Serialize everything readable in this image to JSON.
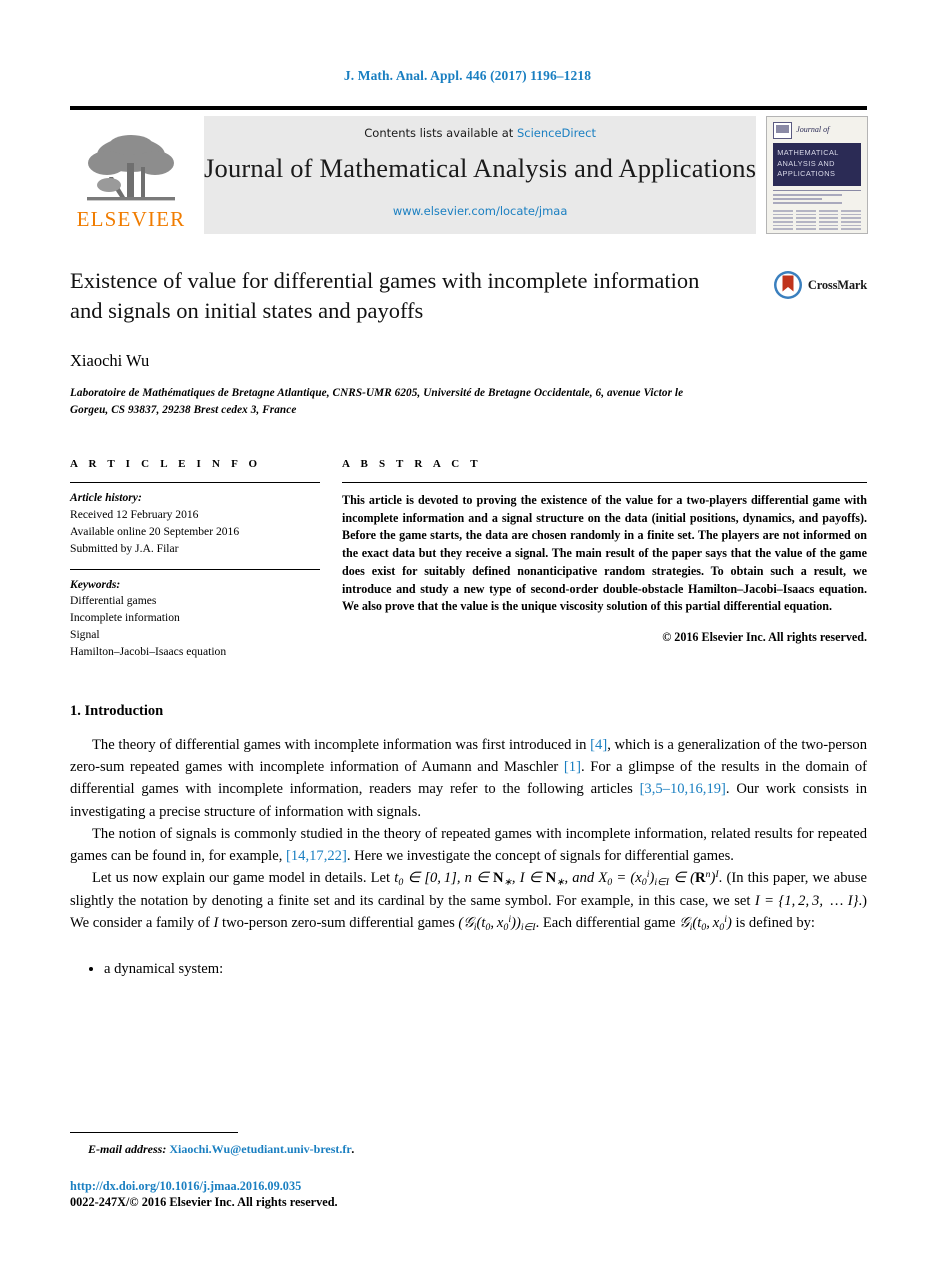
{
  "running_head": "J. Math. Anal. Appl. 446 (2017) 1196–1218",
  "masthead": {
    "contents_prefix": "Contents lists available at",
    "sciencedirect_link": "ScienceDirect",
    "journal_title": "Journal of Mathematical Analysis and Applications",
    "journal_url": "www.elsevier.com/locate/jmaa",
    "publisher_name": "ELSEVIER",
    "cover": {
      "journal_of": "Journal of",
      "band_line1": "MATHEMATICAL",
      "band_line2": "ANALYSIS AND",
      "band_line3": "APPLICATIONS"
    }
  },
  "article": {
    "title": "Existence of value for differential games with incomplete information and signals on initial states and payoffs",
    "author": "Xiaochi Wu",
    "affiliation": "Laboratoire de Mathématiques de Bretagne Atlantique, CNRS-UMR 6205, Université de Bretagne Occidentale, 6, avenue Victor le Gorgeu, CS 93837, 29238 Brest cedex 3, France",
    "crossmark_label": "CrossMark"
  },
  "article_info": {
    "heading": "A R T I C L E   I N F O",
    "history_label": "Article history:",
    "history": [
      "Received 12 February 2016",
      "Available online 20 September 2016",
      "Submitted by J.A. Filar"
    ],
    "keywords_label": "Keywords:",
    "keywords": [
      "Differential games",
      "Incomplete information",
      "Signal",
      "Hamilton–Jacobi–Isaacs equation"
    ]
  },
  "abstract": {
    "heading": "A B S T R A C T",
    "text": "This article is devoted to proving the existence of the value for a two-players differential game with incomplete information and a signal structure on the data (initial positions, dynamics, and payoffs). Before the game starts, the data are chosen randomly in a finite set. The players are not informed on the exact data but they receive a signal. The main result of the paper says that the value of the game does exist for suitably defined nonanticipative random strategies. To obtain such a result, we introduce and study a new type of second-order double-obstacle Hamilton–Jacobi–Isaacs equation. We also prove that the value is the unique viscosity solution of this partial differential equation.",
    "copyright": "© 2016 Elsevier Inc. All rights reserved."
  },
  "introduction": {
    "section_title": "1. Introduction",
    "para1_a": "The theory of differential games with incomplete information was first introduced in ",
    "para1_ref1": "[4]",
    "para1_b": ", which is a generalization of the two-person zero-sum repeated games with incomplete information of Aumann and Maschler ",
    "para1_ref2": "[1]",
    "para1_c": ". For a glimpse of the results in the domain of differential games with incomplete information, readers may refer to the following articles ",
    "para1_ref3": "[3,5–10,16,19]",
    "para1_d": ". Our work consists in investigating a precise structure of information with signals.",
    "para2_a": "The notion of signals is commonly studied in the theory of repeated games with incomplete information, related results for repeated games can be found in, for example, ",
    "para2_ref1": "[14,17,22]",
    "para2_b": ". Here we investigate the concept of signals for differential games.",
    "para3_a": "Let us now explain our game model in details. Let ",
    "para3_math1": "t₀ ∈ [0, 1], n ∈ N∗, I ∈ N∗, and X₀ = (x₀ⁱ)ᵢ∈I ∈ (Rⁿ)ᴵ",
    "para3_b": ". (In this paper, we abuse slightly the notation by denoting a finite set and its cardinal by the same symbol. For example, in this case, we set ",
    "para3_math2": "I = {1, 2, 3, … I}",
    "para3_c": ".) We consider a family of ",
    "para3_math3": "I",
    "para3_d": " two-person zero-sum differential games ",
    "para3_math4": "(Gᵢ(t₀, x₀ⁱ))ᵢ∈I",
    "para3_e": ". Each differential game ",
    "para3_math5": "Gᵢ(t₀, x₀ⁱ)",
    "para3_f": " is defined by:",
    "bullets": [
      "a dynamical system:"
    ]
  },
  "footer": {
    "email_label": "E-mail address:",
    "email_address": "Xiaochi.Wu@etudiant.univ-brest.fr",
    "email_period": ".",
    "doi": "http://dx.doi.org/10.1016/j.jmaa.2016.09.035",
    "issn_line": "0022-247X/© 2016 Elsevier Inc. All rights reserved."
  },
  "colors": {
    "link_blue": "#1a7fc1",
    "elsevier_orange": "#f07c00",
    "cover_navy": "#2b2b55",
    "band_gray": "#e9e9e9"
  }
}
